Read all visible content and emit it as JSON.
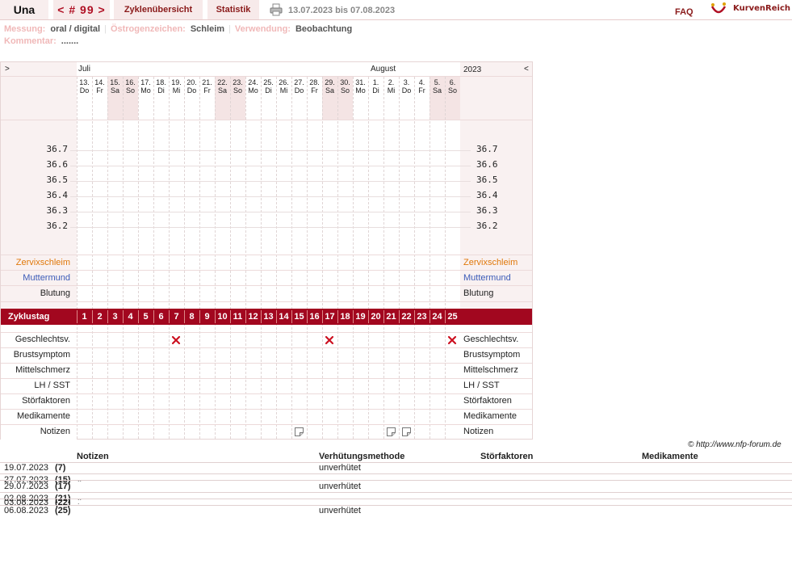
{
  "topbar": {
    "name": "Una",
    "cycle": "< # 99 >",
    "overview": "Zyklenübersicht",
    "stats": "Statistik",
    "range": "13.07.2023 bis 07.08.2023",
    "faq": "FAQ",
    "brand": "KurvenReich"
  },
  "meta": {
    "messung_label": "Messung:",
    "messung_value": "oral / digital",
    "oestrogen_label": "Östrogenzeichen:",
    "oestrogen_value": "Schleim",
    "verwendung_label": "Verwendung:",
    "verwendung_value": "Beobachtung",
    "kommentar_label": "Kommentar:",
    "kommentar_value": "......."
  },
  "chart": {
    "nav_left": ">",
    "nav_right": "<",
    "year": "2023",
    "months": [
      {
        "label": "Juli",
        "col": 0
      },
      {
        "label": "August",
        "col": 19
      }
    ],
    "days": [
      {
        "d": "13.",
        "w": "Do",
        "we": false
      },
      {
        "d": "14.",
        "w": "Fr",
        "we": false
      },
      {
        "d": "15.",
        "w": "Sa",
        "we": true
      },
      {
        "d": "16.",
        "w": "So",
        "we": true
      },
      {
        "d": "17.",
        "w": "Mo",
        "we": false
      },
      {
        "d": "18.",
        "w": "Di",
        "we": false
      },
      {
        "d": "19.",
        "w": "Mi",
        "we": false
      },
      {
        "d": "20.",
        "w": "Do",
        "we": false
      },
      {
        "d": "21.",
        "w": "Fr",
        "we": false
      },
      {
        "d": "22.",
        "w": "Sa",
        "we": true
      },
      {
        "d": "23.",
        "w": "So",
        "we": true
      },
      {
        "d": "24.",
        "w": "Mo",
        "we": false
      },
      {
        "d": "25.",
        "w": "Di",
        "we": false
      },
      {
        "d": "26.",
        "w": "Mi",
        "we": false
      },
      {
        "d": "27.",
        "w": "Do",
        "we": false
      },
      {
        "d": "28.",
        "w": "Fr",
        "we": false
      },
      {
        "d": "29.",
        "w": "Sa",
        "we": true
      },
      {
        "d": "30.",
        "w": "So",
        "we": true
      },
      {
        "d": "31.",
        "w": "Mo",
        "we": false
      },
      {
        "d": "1.",
        "w": "Di",
        "we": false
      },
      {
        "d": "2.",
        "w": "Mi",
        "we": false
      },
      {
        "d": "3.",
        "w": "Do",
        "we": false
      },
      {
        "d": "4.",
        "w": "Fr",
        "we": false
      },
      {
        "d": "5.",
        "w": "Sa",
        "we": true
      },
      {
        "d": "6.",
        "w": "So",
        "we": true
      }
    ],
    "temps": [
      "36.7",
      "36.6",
      "36.5",
      "36.4",
      "36.3",
      "36.2"
    ],
    "rows_upper": [
      {
        "label": "Zervixschleim",
        "color": "orange"
      },
      {
        "label": "Muttermund",
        "color": "blue"
      },
      {
        "label": "Blutung",
        "color": "black"
      }
    ],
    "cycle_label": "Zyklustag",
    "cycle_days": [
      "1",
      "2",
      "3",
      "4",
      "5",
      "6",
      "7",
      "8",
      "9",
      "10",
      "11",
      "12",
      "13",
      "14",
      "15",
      "16",
      "17",
      "18",
      "19",
      "20",
      "21",
      "22",
      "23",
      "24",
      "25"
    ],
    "rows_lower": [
      "Geschlechtsv.",
      "Brustsymptom",
      "Mittelschmerz",
      "LH / SST",
      "Störfaktoren",
      "Medikamente",
      "Notizen"
    ],
    "intercourse_days": [
      7,
      17,
      25
    ],
    "note_days": [
      15,
      21,
      22
    ]
  },
  "copyright": "© http://www.nfp-forum.de",
  "notes": {
    "headers": [
      "Notizen",
      "Verhütungsmethode",
      "Störfaktoren",
      "Medikamente"
    ],
    "rows": [
      {
        "date": "19.07.2023",
        "day": "(7)",
        "method": "unverhütet",
        "mark": ""
      },
      {
        "date": "27.07.2023",
        "day": "(15)",
        "method": "",
        "mark": ".."
      },
      {
        "date": "29.07.2023",
        "day": "(17)",
        "method": "unverhütet",
        "mark": ""
      },
      {
        "date": "02.08.2023",
        "day": "(21)",
        "method": "",
        "mark": ".."
      },
      {
        "date": "03.08.2023",
        "day": "(22)",
        "method": "",
        "mark": "."
      },
      {
        "date": "06.08.2023",
        "day": "(25)",
        "method": "unverhütet",
        "mark": ""
      }
    ]
  },
  "colors": {
    "accent": "#a2071f",
    "tab_bg": "#f7eaea",
    "weekend": "#f4e4e4"
  }
}
